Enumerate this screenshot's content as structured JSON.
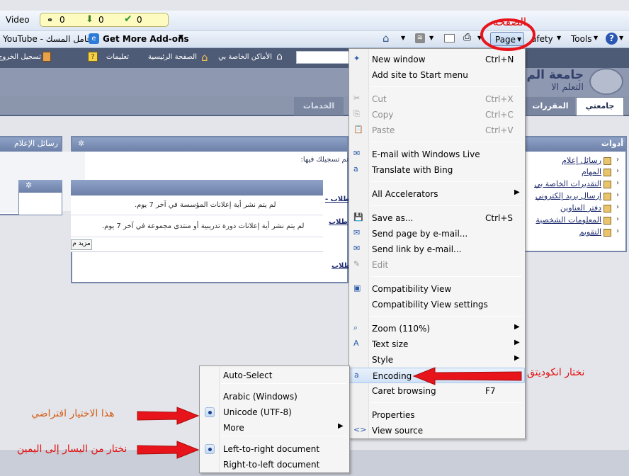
{
  "toolbar": {
    "video_label": "Video",
    "badge_counts": [
      "0",
      "0",
      "0"
    ],
    "favorites": [
      "YouTube - حامل المسك",
      "Get More Add-ons"
    ],
    "command_bar": {
      "page_label": "Page",
      "safety_label": "afety",
      "tools_label": "Tools"
    }
  },
  "site": {
    "top_links": [
      "الأماكن الخاصة بي",
      "الصفحة الرئيسية",
      "تعليمات",
      "تسجيل الخروج"
    ],
    "title_line1": "جامعة الم",
    "title_line2": "التعلم الا",
    "tabs": [
      "جامعتي",
      "المقررات ال",
      "الخدمات"
    ],
    "left_panel_title": "رسائل الإعلام",
    "tools_panel_title": "أدوات",
    "tools_items": [
      "رسائل إعلام",
      "المهام",
      "التقديرات الخاصة بي",
      "إرسال بريد إلكتروني",
      "دفتر العناوين",
      "المعلومات الشخصية",
      "التقويم"
    ],
    "center_header": "تم تسجيلك فيها:",
    "notices": [
      "لم يتم نشر أية إعلانات المؤسسة في آخر 7 يوم.",
      "لم يتم نشر أية إعلانات دورة تدريبية أو منتدى مجموعة في آخر 7 يوم."
    ],
    "more_button": "مزيد م",
    "student_links": [
      "- طلاب",
      "طلاب",
      "طلاب"
    ]
  },
  "page_menu": {
    "items": [
      {
        "label": "New window",
        "shortcut": "Ctrl+N"
      },
      {
        "label": "Add site to Start menu",
        "shortcut": ""
      },
      {
        "label": "Cut",
        "shortcut": "Ctrl+X"
      },
      {
        "label": "Copy",
        "shortcut": "Ctrl+C"
      },
      {
        "label": "Paste",
        "shortcut": "Ctrl+V"
      },
      {
        "label": "E-mail with Windows Live",
        "shortcut": ""
      },
      {
        "label": "Translate with Bing",
        "shortcut": ""
      },
      {
        "label": "All Accelerators",
        "shortcut": ""
      },
      {
        "label": "Save as...",
        "shortcut": "Ctrl+S"
      },
      {
        "label": "Send page by e-mail...",
        "shortcut": ""
      },
      {
        "label": "Send link by e-mail...",
        "shortcut": ""
      },
      {
        "label": "Edit",
        "shortcut": ""
      },
      {
        "label": "Compatibility View",
        "shortcut": ""
      },
      {
        "label": "Compatibility View settings",
        "shortcut": ""
      },
      {
        "label": "Zoom (110%)",
        "shortcut": ""
      },
      {
        "label": "Text size",
        "shortcut": ""
      },
      {
        "label": "Style",
        "shortcut": ""
      },
      {
        "label": "Encoding",
        "shortcut": ""
      },
      {
        "label": "Caret browsing",
        "shortcut": "F7"
      },
      {
        "label": "Properties",
        "shortcut": ""
      },
      {
        "label": "View source",
        "shortcut": ""
      }
    ]
  },
  "encoding_menu": {
    "items": [
      "Auto-Select",
      "Arabic (Windows)",
      "Unicode (UTF-8)",
      "More",
      "Left-to-right document",
      "Right-to-left document"
    ]
  },
  "annotations": {
    "page_label": "الصفحة",
    "encoding": "نختار انكوديتق",
    "default_choice": "هذا الاختيار افتراضي",
    "direction": "نختار من اليسار إلى اليمين"
  },
  "colors": {
    "annotation_red": "#e01010",
    "annotation_orange": "#d4601a",
    "highlight_circle": "#e8141c"
  }
}
